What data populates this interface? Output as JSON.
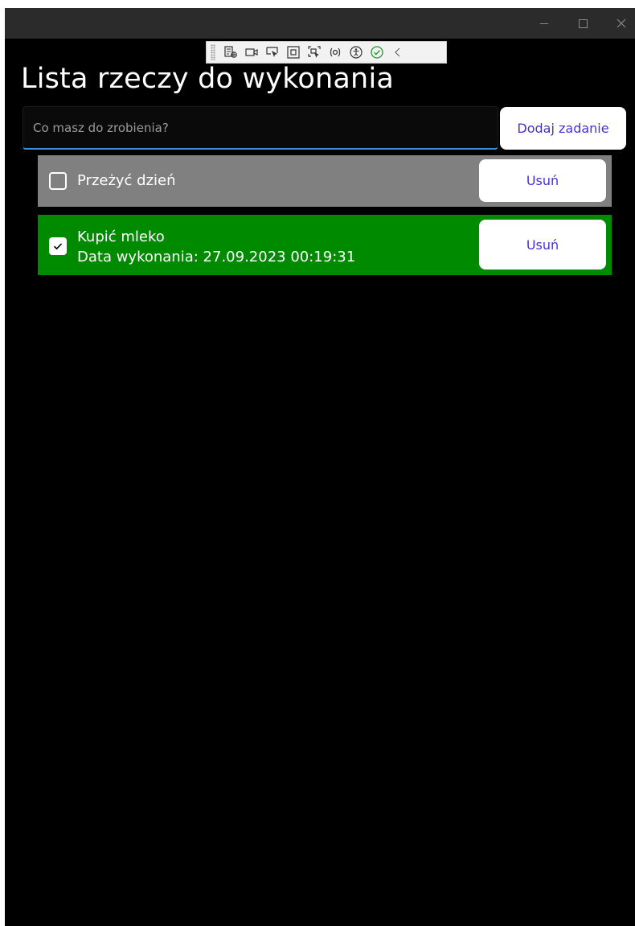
{
  "window": {
    "controls": {
      "minimize": "–",
      "maximize": "□",
      "close": "✕"
    }
  },
  "devtools": {
    "icons": [
      "live-visual-tree-icon",
      "record-icon",
      "select-element-icon",
      "display-layout-adorners-icon",
      "track-focus-icon",
      "binding-failures-icon",
      "accessibility-checker-icon",
      "hot-reload-ok-icon",
      "collapse-icon"
    ]
  },
  "app": {
    "title": "Lista rzeczy do wykonania",
    "new_task": {
      "placeholder": "Co masz do zrobienia?",
      "value": ""
    },
    "add_button": "Dodaj zadanie"
  },
  "tasks": [
    {
      "title": "Przeżyć dzień",
      "completed": false,
      "completed_info": "",
      "remove_label": "Usuń",
      "color": "#808080"
    },
    {
      "title": "Kupić mleko",
      "completed": true,
      "completed_info": "Data wykonania: 27.09.2023 00:19:31",
      "remove_label": "Usuń",
      "color": "#008a00"
    }
  ],
  "colors": {
    "window_bg": "#000000",
    "titlebar": "#2b2b2b",
    "accent": "#3a8fd6",
    "button_text": "#4b2fd6",
    "pending": "#808080",
    "done": "#008a00"
  }
}
